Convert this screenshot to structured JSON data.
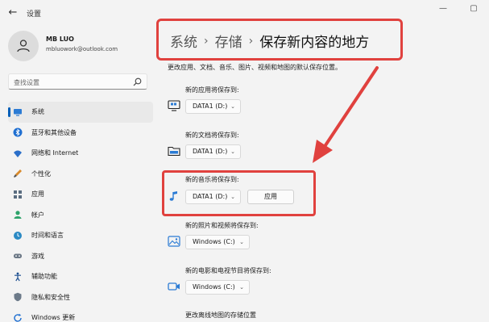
{
  "window": {
    "title": "设置",
    "back_glyph": "←",
    "minimize_glyph": "—",
    "maximize_glyph": "▢"
  },
  "profile": {
    "name": "MB LUO",
    "email": "mbluowork@outlook.com"
  },
  "search": {
    "placeholder": "查找设置"
  },
  "sidebar": {
    "items": [
      {
        "label": "系统",
        "icon": "monitor-icon",
        "active": true
      },
      {
        "label": "蓝牙和其他设备",
        "icon": "bluetooth-icon"
      },
      {
        "label": "网络和 Internet",
        "icon": "wifi-icon"
      },
      {
        "label": "个性化",
        "icon": "brush-icon"
      },
      {
        "label": "应用",
        "icon": "apps-icon"
      },
      {
        "label": "帐户",
        "icon": "person-icon"
      },
      {
        "label": "时间和语言",
        "icon": "globe-clock-icon"
      },
      {
        "label": "游戏",
        "icon": "gamepad-icon"
      },
      {
        "label": "辅助功能",
        "icon": "accessibility-icon"
      },
      {
        "label": "隐私和安全性",
        "icon": "shield-icon"
      },
      {
        "label": "Windows 更新",
        "icon": "update-icon"
      }
    ]
  },
  "breadcrumb": {
    "part1": "系统",
    "part2": "存储",
    "current": "保存新内容的地方",
    "sep": "›"
  },
  "main": {
    "description": "更改应用、文档、音乐、图片、视频和地图的默认保存位置。",
    "settings": [
      {
        "label": "新的应用将保存到:",
        "value": "DATA1 (D:)",
        "icon": "app-monitor-icon"
      },
      {
        "label": "新的文档将保存到:",
        "value": "DATA1 (D:)",
        "icon": "folder-icon"
      },
      {
        "label": "新的音乐将保存到:",
        "value": "DATA1 (D:)",
        "icon": "music-note-icon",
        "button": "应用"
      },
      {
        "label": "新的照片和视频将保存到:",
        "value": "Windows (C:)",
        "icon": "photo-icon"
      },
      {
        "label": "新的电影和电视节目将保存到:",
        "value": "Windows (C:)",
        "icon": "video-icon"
      },
      {
        "label": "更改离线地图的存储位置"
      }
    ],
    "chevron": "⌄"
  },
  "colors": {
    "accent": "#005fb8",
    "annotation_red": "#e0413e",
    "background": "#f3f3f3"
  }
}
